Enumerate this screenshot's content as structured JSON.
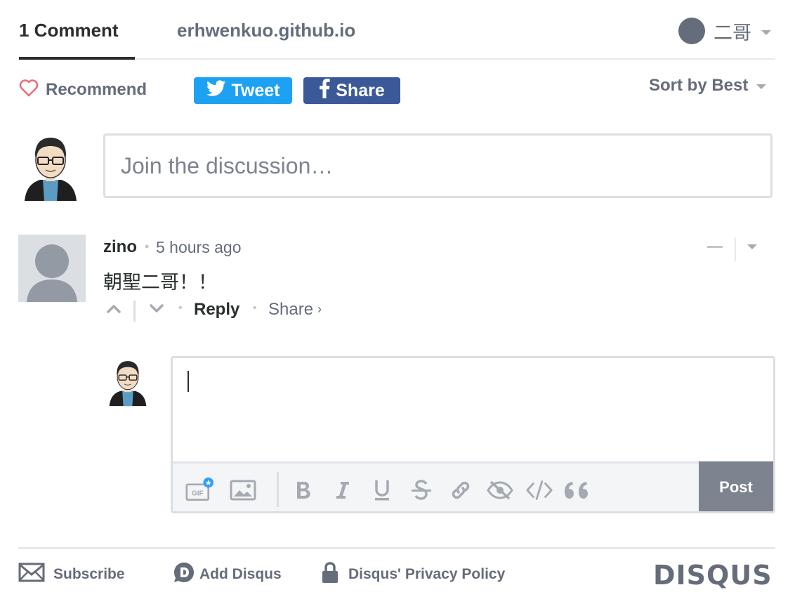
{
  "nav": {
    "comments_tab": "1 Comment",
    "site_tab": "erhwenkuo.github.io",
    "user_name": "二哥"
  },
  "actions": {
    "recommend": "Recommend",
    "tweet": "Tweet",
    "share": "Share",
    "sort": "Sort by Best"
  },
  "composer": {
    "placeholder": "Join the discussion…"
  },
  "comment": {
    "author": "zino",
    "separator": "•",
    "time": "5 hours ago",
    "body": "朝聖二哥！！",
    "reply": "Reply",
    "share": "Share",
    "share_chevron": "›"
  },
  "reply_box": {
    "toolbar": [
      "gif-icon",
      "image-icon",
      "bold-icon",
      "italic-icon",
      "underline-icon",
      "strikethrough-icon",
      "link-icon",
      "spoiler-icon",
      "code-icon",
      "quote-icon"
    ],
    "gif_label": "GIF",
    "post": "Post"
  },
  "footer": {
    "subscribe": "Subscribe",
    "add_disqus": "Add Disqus",
    "privacy": "Disqus' Privacy Policy",
    "logo": "DISQUS"
  },
  "colors": {
    "text": "#2a2e2e",
    "muted": "#656c7a",
    "twitter": "#1da1f2",
    "facebook": "#3b5998",
    "heart": "#e76c7b",
    "post_button": "#7d848f",
    "badge": "#2e9fff"
  }
}
